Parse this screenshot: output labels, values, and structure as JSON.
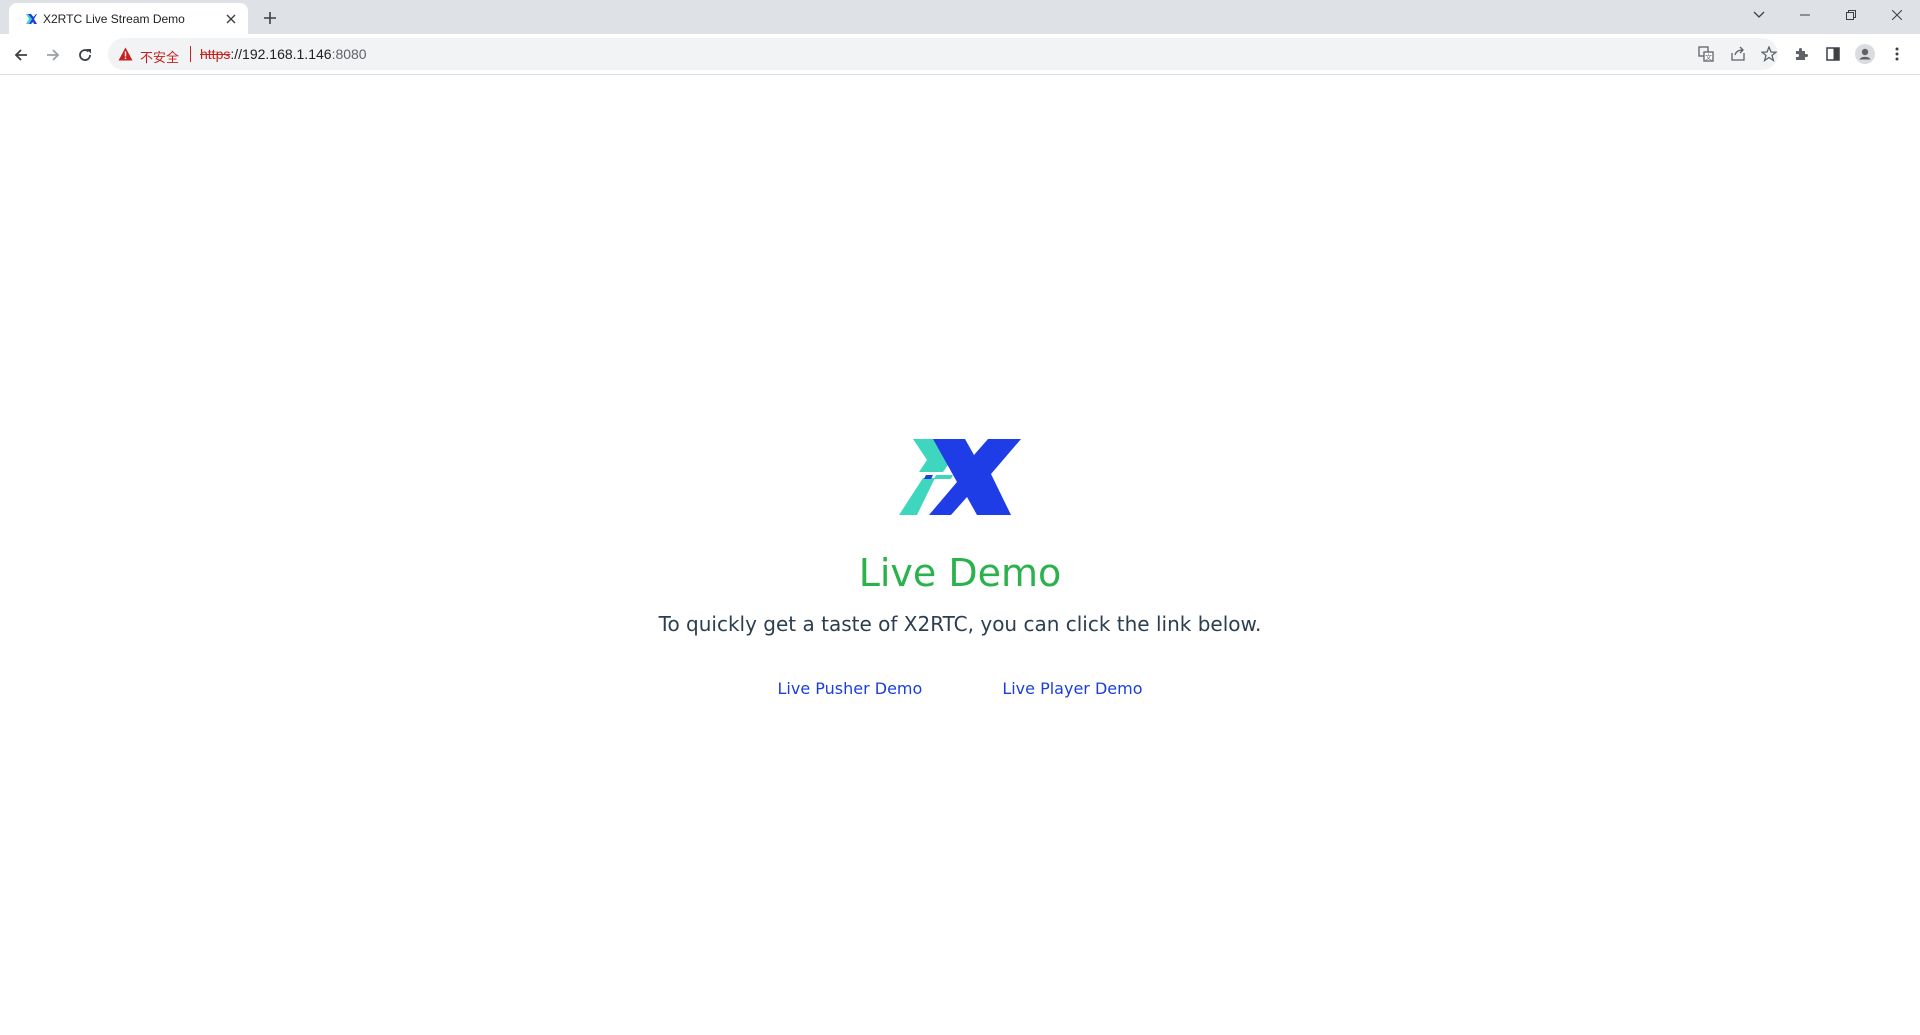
{
  "browser": {
    "tab": {
      "title": "X2RTC Live Stream Demo",
      "favicon": "x2rtc-logo-icon",
      "close_icon": "close-icon"
    },
    "new_tab_icon": "plus-icon",
    "window_controls": [
      "chevron-down-icon",
      "minimize-icon",
      "restore-icon",
      "close-icon"
    ],
    "address_bar": {
      "security_label": "不安全",
      "url_scheme": "https",
      "url_host": "://192.168.1.146",
      "url_port": ":8080"
    },
    "toolbar_icons": [
      "translate-icon",
      "share-icon",
      "star-icon",
      "extensions-icon",
      "side-panel-icon",
      "profile-icon",
      "menu-icon"
    ]
  },
  "page": {
    "heading": "Live Demo",
    "subtitle": "To quickly get a taste of X2RTC, you can click the link below.",
    "links": {
      "pusher": "Live Pusher Demo",
      "player": "Live Player Demo"
    }
  },
  "colors": {
    "heading": "#2bb24c",
    "link": "#1a3fd6",
    "logo_blue": "#1f3de6",
    "logo_teal": "#3fd6c0",
    "insecure_red": "#c5221f"
  }
}
